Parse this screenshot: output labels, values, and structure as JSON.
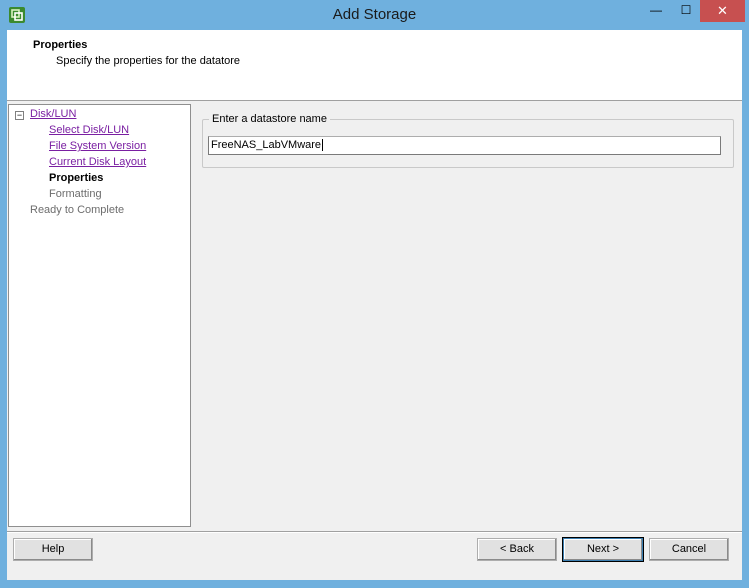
{
  "window": {
    "title": "Add Storage",
    "minimize_glyph": "—",
    "maximize_glyph": "☐",
    "close_glyph": "✕"
  },
  "header": {
    "title": "Properties",
    "subtitle": "Specify the properties for the datatore"
  },
  "nav": {
    "toggle_glyph": "−",
    "items": [
      {
        "label": "Disk/LUN"
      },
      {
        "label": "Select Disk/LUN"
      },
      {
        "label": "File System Version"
      },
      {
        "label": "Current Disk Layout"
      },
      {
        "label": "Properties"
      },
      {
        "label": "Formatting"
      },
      {
        "label": "Ready to Complete"
      }
    ]
  },
  "form": {
    "group_label": "Enter a datastore name",
    "datastore_name": "FreeNAS_LabVMware"
  },
  "buttons": {
    "help": "Help",
    "back": "< Back",
    "next": "Next >",
    "cancel": "Cancel"
  },
  "colors": {
    "title_bar": "#6fb0de",
    "close_button": "#c75050",
    "link": "#7a1fa2"
  }
}
